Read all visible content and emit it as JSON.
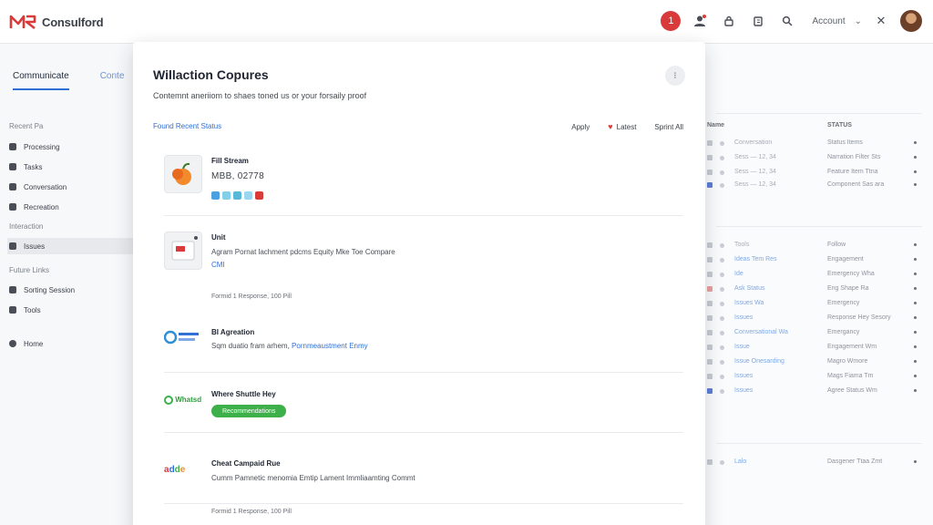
{
  "header": {
    "app_name": "Consulford",
    "notification_badge": "1",
    "user_label": "Account",
    "icons": [
      "alert-icon",
      "user-icon",
      "lock-icon",
      "copy-icon",
      "search-icon",
      "chevron-down-icon",
      "close-icon"
    ]
  },
  "sidebar": {
    "tabs": [
      {
        "label": "Communicate",
        "active": true
      },
      {
        "label": "Conte",
        "active": false
      }
    ],
    "sections": [
      {
        "label": "Recent Pa",
        "items": [
          "Processing",
          "Tasks",
          "Conversation",
          "Recreation"
        ]
      },
      {
        "label": "Interaction",
        "items": [
          "Issues"
        ]
      },
      {
        "label": "Future Links",
        "items": [
          "Sorting Session",
          "Tools"
        ]
      },
      {
        "label": "",
        "items": [
          "Home"
        ]
      }
    ],
    "selected_item": "Issues"
  },
  "modal": {
    "title": "Willaction Copures",
    "subtitle": "Contemnt aneriiom to shaes toned us or your forsaily proof",
    "filter_link": "Found Recent Status",
    "sort_options": [
      "Apply",
      "Latest",
      "Sprint All"
    ],
    "entries": [
      {
        "title": "Fill Stream",
        "number": "MBB, 02778",
        "chips": [
          "#4aa0e0",
          "#7fd0e8",
          "#58b8d8",
          "#9ad6ef",
          "#d93a3a"
        ]
      },
      {
        "title": "Unit",
        "text": "Agram Pornat lachment pdcms Equity Mke Toe Compare",
        "link": "CMI",
        "meta": "Formid 1   Response, 100 Pill"
      },
      {
        "title": "BI Agreation",
        "text": "Sqm duatio fram arhem,",
        "link": "Pornmeaustment Enmy"
      },
      {
        "title": "Where Shuttle Hey",
        "pill": "Recommendations",
        "logo": "Whatsd"
      },
      {
        "title": "Cheat Campaid Rue",
        "text": "Cumm Pamnetic menomia Emtip Lament Immliaamting Commt",
        "meta": "Formid 1   Response, 100 Pill",
        "logo": "adde"
      }
    ]
  },
  "right_panel": {
    "headers": [
      "Name",
      "STATUS"
    ],
    "rows": [
      {
        "left": "Conversation",
        "right": "Status Items"
      },
      {
        "left": "Sess — 12, 34",
        "right": "Narration Filter Sts"
      },
      {
        "left": "Sess — 12, 34",
        "right": "Feature Item Ttna"
      },
      {
        "left": "Sess — 12, 34",
        "right": "Component Sas ara"
      },
      {
        "left": "Tools",
        "right": "Follow"
      },
      {
        "left": "Ideas Tem Res",
        "right": "Engagement"
      },
      {
        "left": "Ide",
        "right": "Emergency Wha"
      },
      {
        "left": "Ask Status",
        "right": "Eng Shape Ra"
      },
      {
        "left": "Issues Wa",
        "right": "Emergency"
      },
      {
        "left": "Issues",
        "right": "Response Hey Sesory"
      },
      {
        "left": "Conversational Wa",
        "right": "Emergancy"
      },
      {
        "left": "Issue",
        "right": "Engagement Wm"
      },
      {
        "left": "Issue Onesarding",
        "right": "Magro Wmore"
      },
      {
        "left": "Issues",
        "right": "Mags Fiama Tm"
      },
      {
        "left": "Issues",
        "right": "Agree Status Wm"
      },
      {
        "left": "Lalo",
        "right": "Dasgener Ttaa Zmt"
      }
    ]
  }
}
